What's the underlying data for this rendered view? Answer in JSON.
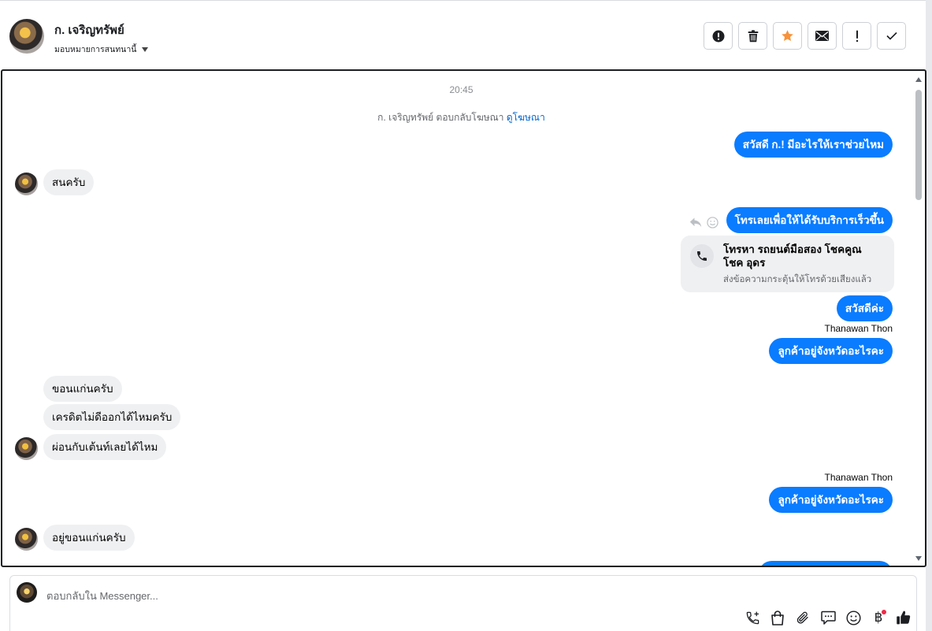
{
  "header": {
    "contact_name": "ก. เจริญทรัพย์",
    "assign_label": "มอบหมายการสนทนานี้",
    "actions": [
      {
        "name": "report-spam",
        "icon": "exclamation-circle-icon"
      },
      {
        "name": "delete",
        "icon": "trash-icon"
      },
      {
        "name": "star",
        "icon": "star-icon",
        "color": "#f7923b"
      },
      {
        "name": "mark-unread",
        "icon": "envelope-icon"
      },
      {
        "name": "follow-up",
        "icon": "exclamation-icon"
      },
      {
        "name": "mark-done",
        "icon": "check-icon"
      }
    ]
  },
  "conversation": {
    "timestamp": "20:45",
    "system_text": "ก. เจริญทรัพย์ ตอบกลับโฆษณา",
    "system_link": "ดูโฆษณา",
    "messages": [
      {
        "dir": "out",
        "text": "สวัสดี ก.! มีอะไรให้เราช่วยไหม"
      },
      {
        "dir": "in",
        "text": "สนครับ"
      },
      {
        "dir": "out",
        "text": "โทรเลยเพื่อให้ได้รับบริการเร็วขึ้น"
      },
      {
        "dir": "out",
        "text": "สวัสดีค่ะ"
      },
      {
        "dir": "out",
        "sender": "Thanawan Thon",
        "text": "ลูกค้าอยู่จังหวัดอะไรคะ"
      },
      {
        "dir": "in",
        "text": "ขอนแก่นครับ"
      },
      {
        "dir": "in",
        "text": "เครดิตไม่ดีออกได้ไหมครับ"
      },
      {
        "dir": "in",
        "text": "ผ่อนกับเต้นท์เลยได้ไหม"
      },
      {
        "dir": "out",
        "sender": "Thanawan Thon",
        "text": "ลูกค้าอยู่จังหวัดอะไรคะ"
      },
      {
        "dir": "in",
        "text": "อยู่ขอนแก่นครับ"
      }
    ],
    "call_card": {
      "title": "โทรหา รถยนต์มือสอง โชคคูณ โชค อุดร",
      "subtitle": "ส่งข้อความกระตุ้นให้โทรด้วยเสียงแล้ว"
    }
  },
  "composer": {
    "placeholder": "ตอบกลับใน Messenger...",
    "tools": [
      "phone-plus-icon",
      "shopping-bag-icon",
      "paperclip-icon",
      "chat-bubble-icon",
      "smiley-icon",
      "baht-icon",
      "thumbs-up-icon"
    ],
    "baht_symbol": "฿",
    "accent": "#0a7cff"
  }
}
